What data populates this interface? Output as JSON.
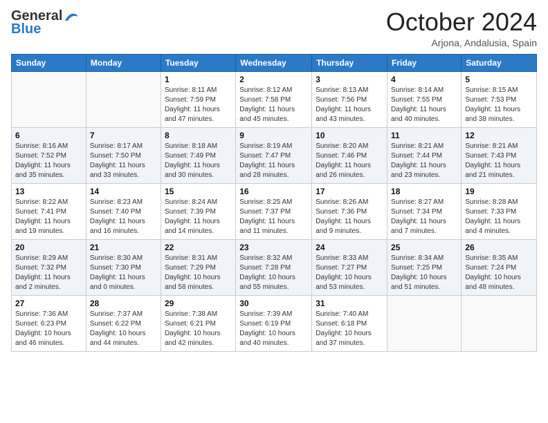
{
  "logo": {
    "line1": "General",
    "line2": "Blue"
  },
  "title": "October 2024",
  "location": "Arjona, Andalusia, Spain",
  "weekdays": [
    "Sunday",
    "Monday",
    "Tuesday",
    "Wednesday",
    "Thursday",
    "Friday",
    "Saturday"
  ],
  "weeks": [
    [
      {
        "day": "",
        "info": ""
      },
      {
        "day": "",
        "info": ""
      },
      {
        "day": "1",
        "info": "Sunrise: 8:11 AM\nSunset: 7:59 PM\nDaylight: 11 hours and 47 minutes."
      },
      {
        "day": "2",
        "info": "Sunrise: 8:12 AM\nSunset: 7:58 PM\nDaylight: 11 hours and 45 minutes."
      },
      {
        "day": "3",
        "info": "Sunrise: 8:13 AM\nSunset: 7:56 PM\nDaylight: 11 hours and 43 minutes."
      },
      {
        "day": "4",
        "info": "Sunrise: 8:14 AM\nSunset: 7:55 PM\nDaylight: 11 hours and 40 minutes."
      },
      {
        "day": "5",
        "info": "Sunrise: 8:15 AM\nSunset: 7:53 PM\nDaylight: 11 hours and 38 minutes."
      }
    ],
    [
      {
        "day": "6",
        "info": "Sunrise: 8:16 AM\nSunset: 7:52 PM\nDaylight: 11 hours and 35 minutes."
      },
      {
        "day": "7",
        "info": "Sunrise: 8:17 AM\nSunset: 7:50 PM\nDaylight: 11 hours and 33 minutes."
      },
      {
        "day": "8",
        "info": "Sunrise: 8:18 AM\nSunset: 7:49 PM\nDaylight: 11 hours and 30 minutes."
      },
      {
        "day": "9",
        "info": "Sunrise: 8:19 AM\nSunset: 7:47 PM\nDaylight: 11 hours and 28 minutes."
      },
      {
        "day": "10",
        "info": "Sunrise: 8:20 AM\nSunset: 7:46 PM\nDaylight: 11 hours and 26 minutes."
      },
      {
        "day": "11",
        "info": "Sunrise: 8:21 AM\nSunset: 7:44 PM\nDaylight: 11 hours and 23 minutes."
      },
      {
        "day": "12",
        "info": "Sunrise: 8:21 AM\nSunset: 7:43 PM\nDaylight: 11 hours and 21 minutes."
      }
    ],
    [
      {
        "day": "13",
        "info": "Sunrise: 8:22 AM\nSunset: 7:41 PM\nDaylight: 11 hours and 19 minutes."
      },
      {
        "day": "14",
        "info": "Sunrise: 8:23 AM\nSunset: 7:40 PM\nDaylight: 11 hours and 16 minutes."
      },
      {
        "day": "15",
        "info": "Sunrise: 8:24 AM\nSunset: 7:39 PM\nDaylight: 11 hours and 14 minutes."
      },
      {
        "day": "16",
        "info": "Sunrise: 8:25 AM\nSunset: 7:37 PM\nDaylight: 11 hours and 11 minutes."
      },
      {
        "day": "17",
        "info": "Sunrise: 8:26 AM\nSunset: 7:36 PM\nDaylight: 11 hours and 9 minutes."
      },
      {
        "day": "18",
        "info": "Sunrise: 8:27 AM\nSunset: 7:34 PM\nDaylight: 11 hours and 7 minutes."
      },
      {
        "day": "19",
        "info": "Sunrise: 8:28 AM\nSunset: 7:33 PM\nDaylight: 11 hours and 4 minutes."
      }
    ],
    [
      {
        "day": "20",
        "info": "Sunrise: 8:29 AM\nSunset: 7:32 PM\nDaylight: 11 hours and 2 minutes."
      },
      {
        "day": "21",
        "info": "Sunrise: 8:30 AM\nSunset: 7:30 PM\nDaylight: 11 hours and 0 minutes."
      },
      {
        "day": "22",
        "info": "Sunrise: 8:31 AM\nSunset: 7:29 PM\nDaylight: 10 hours and 58 minutes."
      },
      {
        "day": "23",
        "info": "Sunrise: 8:32 AM\nSunset: 7:28 PM\nDaylight: 10 hours and 55 minutes."
      },
      {
        "day": "24",
        "info": "Sunrise: 8:33 AM\nSunset: 7:27 PM\nDaylight: 10 hours and 53 minutes."
      },
      {
        "day": "25",
        "info": "Sunrise: 8:34 AM\nSunset: 7:25 PM\nDaylight: 10 hours and 51 minutes."
      },
      {
        "day": "26",
        "info": "Sunrise: 8:35 AM\nSunset: 7:24 PM\nDaylight: 10 hours and 48 minutes."
      }
    ],
    [
      {
        "day": "27",
        "info": "Sunrise: 7:36 AM\nSunset: 6:23 PM\nDaylight: 10 hours and 46 minutes."
      },
      {
        "day": "28",
        "info": "Sunrise: 7:37 AM\nSunset: 6:22 PM\nDaylight: 10 hours and 44 minutes."
      },
      {
        "day": "29",
        "info": "Sunrise: 7:38 AM\nSunset: 6:21 PM\nDaylight: 10 hours and 42 minutes."
      },
      {
        "day": "30",
        "info": "Sunrise: 7:39 AM\nSunset: 6:19 PM\nDaylight: 10 hours and 40 minutes."
      },
      {
        "day": "31",
        "info": "Sunrise: 7:40 AM\nSunset: 6:18 PM\nDaylight: 10 hours and 37 minutes."
      },
      {
        "day": "",
        "info": ""
      },
      {
        "day": "",
        "info": ""
      }
    ]
  ]
}
